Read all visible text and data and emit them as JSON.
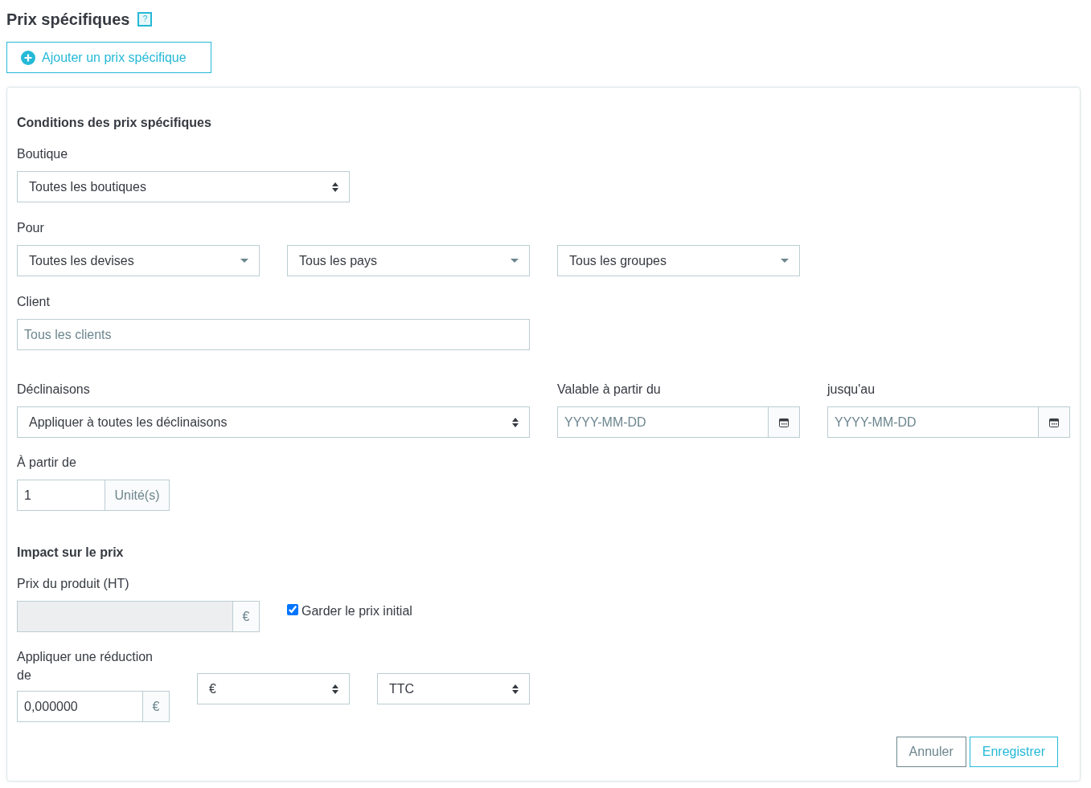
{
  "title": "Prix spécifiques",
  "help_icon": "?",
  "add_button": "Ajouter un prix spécifique",
  "conditions": {
    "heading": "Conditions des prix spécifiques",
    "shop": {
      "label": "Boutique",
      "value": "Toutes les boutiques",
      "kind": "native"
    },
    "for": {
      "label": "Pour",
      "selects": [
        {
          "value": "Toutes les devises",
          "kind": "dropdown"
        },
        {
          "value": "Tous les pays",
          "kind": "dropdown"
        },
        {
          "value": "Tous les groupes",
          "kind": "dropdown"
        }
      ]
    },
    "customer": {
      "label": "Client",
      "placeholder": "Tous les clients"
    },
    "combinations": {
      "label": "Déclinaisons",
      "value": "Appliquer à toutes les déclinaisons",
      "kind": "native"
    },
    "from_date": {
      "label": "Valable à partir du",
      "placeholder": "YYYY-MM-DD"
    },
    "to_date": {
      "label": "jusqu'au",
      "placeholder": "YYYY-MM-DD"
    },
    "from_quantity": {
      "label": "À partir de",
      "value": "1",
      "unit": "Unité(s)"
    }
  },
  "impact": {
    "heading": "Impact sur le prix",
    "product_price": {
      "label": "Prix du produit (HT)",
      "unit": "€",
      "disabled": true
    },
    "keep_price": {
      "label": "Garder le prix initial",
      "checked": true
    },
    "discount": {
      "label": "Appliquer une réduction de",
      "value": "0,000000",
      "unit": "€"
    },
    "discount_type": {
      "value": "€",
      "kind": "native"
    },
    "tax": {
      "value": "TTC",
      "kind": "native"
    }
  },
  "buttons": [
    {
      "label": "Annuler",
      "kind": "secondary"
    },
    {
      "label": "Enregistrer",
      "kind": "primary"
    }
  ]
}
